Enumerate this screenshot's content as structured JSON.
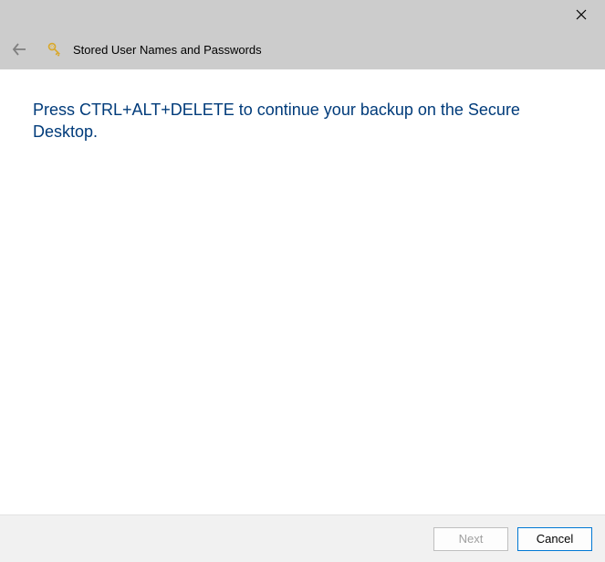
{
  "titlebar": {
    "close_label": "Close"
  },
  "header": {
    "title": "Stored User Names and Passwords"
  },
  "content": {
    "instruction": "Press CTRL+ALT+DELETE to continue your backup on the Secure Desktop."
  },
  "footer": {
    "next_label": "Next",
    "cancel_label": "Cancel"
  }
}
